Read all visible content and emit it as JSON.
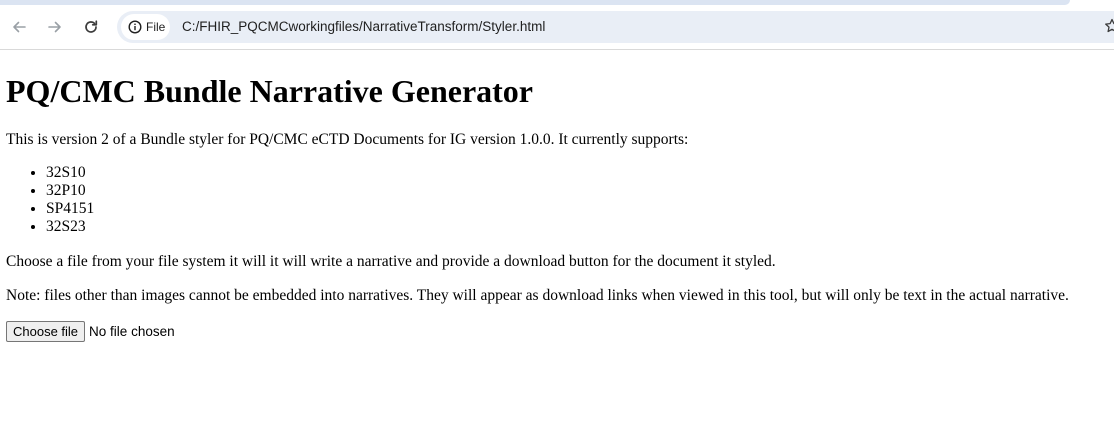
{
  "browser": {
    "chip_label": "File",
    "url": "C:/FHIR_PQCMCworkingfiles/NarrativeTransform/Styler.html",
    "icons": {
      "back": "arrow-left-icon",
      "forward": "arrow-right-icon",
      "reload": "reload-icon",
      "info": "info-icon",
      "bookmark": "star-icon"
    }
  },
  "page": {
    "title": "PQ/CMC Bundle Narrative Generator",
    "intro": "This is version 2 of a Bundle styler for PQ/CMC eCTD Documents for IG version 1.0.0. It currently supports:",
    "supported": [
      "32S10",
      "32P10",
      "SP4151",
      "32S23"
    ],
    "instructions": "Choose a file from your file system it will it will write a narrative and provide a download button for the document it styled.",
    "note": "Note: files other than images cannot be embedded into narratives. They will appear as download links when viewed in this tool, but will only be text in the actual narrative.",
    "file_input": {
      "button_label": "Choose file",
      "status": "No file chosen"
    }
  }
}
